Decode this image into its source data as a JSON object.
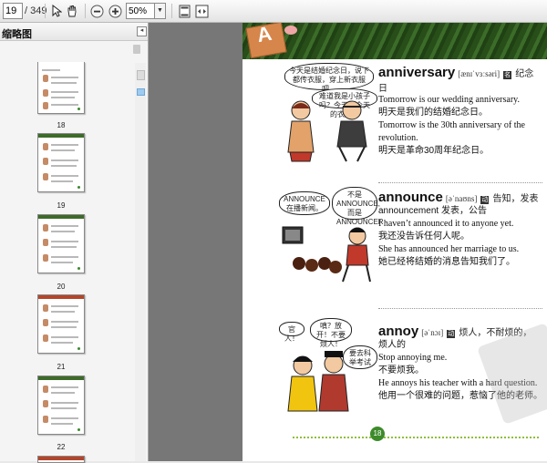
{
  "toolbar": {
    "page_value": "19",
    "page_total": "/ 349",
    "zoom_value": "50%",
    "zoom_arrow": "▼",
    "icons": [
      "select-arrow-icon",
      "hand-icon",
      "zoom-out-icon",
      "zoom-in-icon",
      "fit-page-icon",
      "fit-width-icon"
    ]
  },
  "sidebar": {
    "title": "缩略图",
    "close_label": "◂",
    "thumbnails": [
      {
        "label": "18"
      },
      {
        "label": "19"
      },
      {
        "label": "20"
      },
      {
        "label": "21"
      },
      {
        "label": "22"
      }
    ]
  },
  "page": {
    "banner_letter": "A",
    "entries": [
      {
        "headword": "anniversary",
        "phonetic": "[ænɪˈvɜːsəri]",
        "pos": "名",
        "meaning": "纪念日",
        "lines": [
          {
            "t": "ex",
            "text": "Tomorrow is our wedding anniversary."
          },
          {
            "t": "cn",
            "text": "明天是我们的结婚纪念日。"
          },
          {
            "t": "ex",
            "text": "Tomorrow is the 30th anniversary of the revolution."
          },
          {
            "t": "cn",
            "text": "明天是革命30周年纪念日。"
          }
        ],
        "bubbles": [
          "今天是结婚纪念日，说下都传衣服，穿上新衣服吧。",
          "难道我是小孩子吗？今天穿今天的衣服。"
        ]
      },
      {
        "headword": "announce",
        "phonetic": "[əˈnaʊns]",
        "pos": "动",
        "meaning": "告知，发表",
        "lines": [
          {
            "t": "cn2",
            "text": "announcement 发表，公告"
          },
          {
            "t": "ex",
            "text": "I haven’t announced it to anyone yet."
          },
          {
            "t": "cn",
            "text": "我还没告诉任何人呢。"
          },
          {
            "t": "ex",
            "text": "She has announced her marriage to us."
          },
          {
            "t": "cn",
            "text": "她已经将结婚的消息告知我们了。"
          }
        ],
        "bubbles": [
          "ANNOUNCE 在播新闻。",
          "不是 ANNOUNCE, 而是 ANNOUNCER"
        ]
      },
      {
        "headword": "annoy",
        "phonetic": "[əˈnɔɪ]",
        "pos": "动",
        "meaning": "烦人，不耐烦的，",
        "lines": [
          {
            "t": "cn",
            "text": "烦人的"
          },
          {
            "t": "ex",
            "text": "Stop annoying me."
          },
          {
            "t": "cn",
            "text": "不要烦我。"
          },
          {
            "t": "ex",
            "text": "He annoys his teacher with a hard question."
          },
          {
            "t": "cn",
            "text": "他用一个很难的问题，惹恼了他的老师。"
          }
        ],
        "bubbles": [
          "官人！",
          "嗔？放开！不要烦人！",
          "要去科举考试"
        ]
      }
    ],
    "page_number": "18"
  }
}
